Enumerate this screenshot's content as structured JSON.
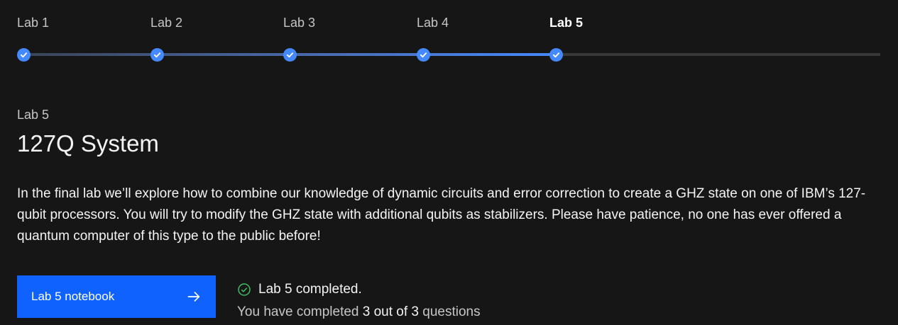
{
  "stepper": {
    "steps": [
      {
        "label": "Lab 1",
        "completed": true
      },
      {
        "label": "Lab 2",
        "completed": true
      },
      {
        "label": "Lab 3",
        "completed": true
      },
      {
        "label": "Lab 4",
        "completed": true
      },
      {
        "label": "Lab 5",
        "completed": true,
        "current": true
      }
    ]
  },
  "lab": {
    "eyebrow": "Lab 5",
    "title": "127Q System",
    "description": "In the final lab we’ll explore how to combine our knowledge of dynamic circuits and error correction to create a GHZ state on one of IBM’s 127-qubit processors. You will try to modify the GHZ state with additional qubits as stabilizers. Please have patience, no one has ever offered a quantum computer of this type to the public before!"
  },
  "actions": {
    "notebook_label": "Lab 5 notebook"
  },
  "status": {
    "completed_text": "Lab 5 completed.",
    "progress_prefix": "You have completed",
    "progress_count": "3 out of 3",
    "progress_suffix": "questions"
  },
  "colors": {
    "background": "#161616",
    "accent": "#4589ff",
    "button": "#0f62fe",
    "success": "#42be65"
  }
}
